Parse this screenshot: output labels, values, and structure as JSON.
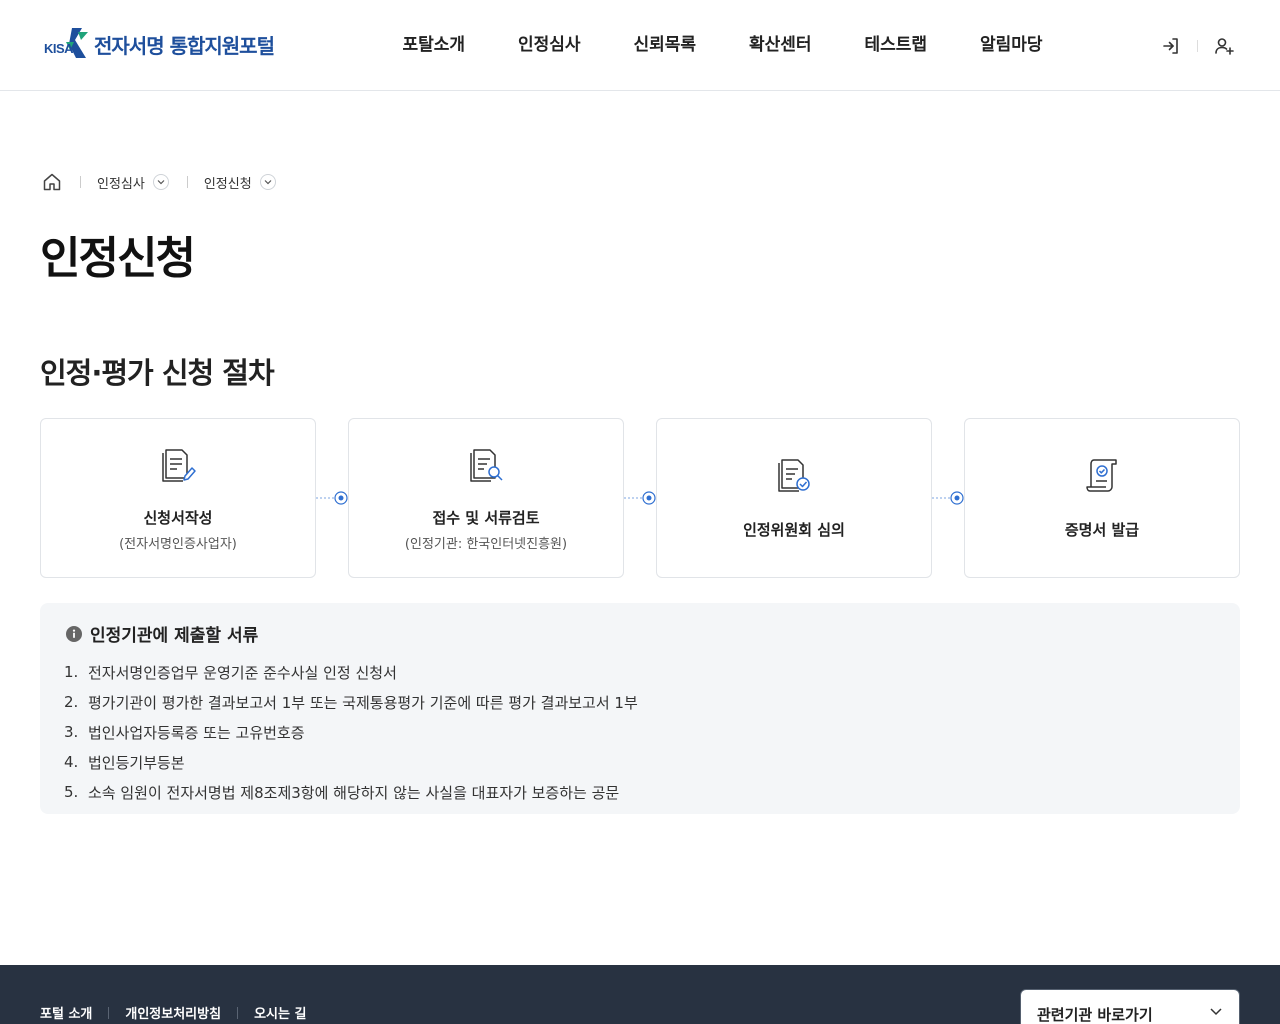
{
  "header": {
    "logo_small": "KISA",
    "logo_text": "전자서명 통합지원포털",
    "nav": [
      "포탈소개",
      "인정심사",
      "신뢰목록",
      "확산센터",
      "테스트랩",
      "알림마당"
    ],
    "icons": [
      "login-icon",
      "user-add-icon"
    ]
  },
  "breadcrumb": {
    "items": [
      "인정심사",
      "인정신청"
    ]
  },
  "page_title": "인정신청",
  "section_title": "인정·평가 신청 절차",
  "steps": [
    {
      "title": "신청서작성",
      "sub": "(전자서명인증사업자)",
      "icon": "document-edit-icon"
    },
    {
      "title": "접수 및 서류검토",
      "sub": "(인정기관: 한국인터넷진흥원)",
      "icon": "document-search-icon"
    },
    {
      "title": "인정위원회 심의",
      "sub": "",
      "icon": "document-check-icon"
    },
    {
      "title": "증명서 발급",
      "sub": "",
      "icon": "certificate-icon"
    }
  ],
  "info": {
    "title": "인정기관에 제출할 서류",
    "items": [
      {
        "num": "1.",
        "text": "전자서명인증업무 운영기준 준수사실 인정 신청서"
      },
      {
        "num": "2.",
        "text": "평가기관이 평가한 결과보고서 1부 또는 국제통용평가 기준에 따른 평가 결과보고서 1부"
      },
      {
        "num": "3.",
        "text": "법인사업자등록증 또는 고유번호증"
      },
      {
        "num": "4.",
        "text": "법인등기부등본"
      },
      {
        "num": "5.",
        "text": "소속 임원이 전자서명법 제8조제3항에 해당하지 않는 사실을 대표자가 보증하는 공문"
      }
    ]
  },
  "footer": {
    "links": [
      "포털 소개",
      "개인정보처리방침",
      "오시는 길"
    ],
    "related_select": "관련기관 바로가기"
  },
  "colors": {
    "brand": "#1e4f9c",
    "accent": "#2f6fd1",
    "footer_bg": "#283241"
  }
}
